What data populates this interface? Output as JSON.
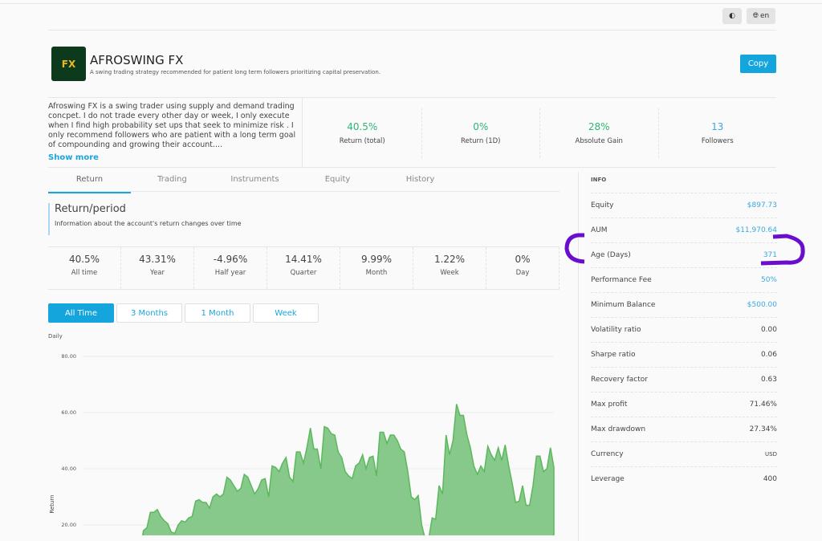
{
  "topbar": {
    "theme_icon": "half-circle-icon",
    "lang_icon": "globe-icon",
    "lang": "en"
  },
  "header": {
    "logo_text": "FX",
    "title": "AFROSWING FX",
    "subtitle": "A swing trading strategy recommended for patient long term followers prioritizing capital preservation.",
    "copy_label": "Copy"
  },
  "description": {
    "text": "Afroswing FX is a swing trader using supply and demand trading concpet. I do not trade every other day or week, I only execute when I find high probability set ups that seek to minimize risk . I only recommend followers who are patient with a long term goal of compounding and growing their account....",
    "show_more": "Show more"
  },
  "stats": [
    {
      "value": "40.5%",
      "label": "Return (total)",
      "color": "#2bb673"
    },
    {
      "value": "0%",
      "label": "Return (1D)",
      "color": "#2bb673"
    },
    {
      "value": "28%",
      "label": "Absolute Gain",
      "color": "#2bb673"
    },
    {
      "value": "13",
      "label": "Followers",
      "color": "#3aa8e0"
    }
  ],
  "tabs": [
    {
      "label": "Return",
      "active": true
    },
    {
      "label": "Trading"
    },
    {
      "label": "Instruments"
    },
    {
      "label": "Equity"
    },
    {
      "label": "History"
    }
  ],
  "return_period": {
    "title": "Return/period",
    "subtitle": "Information about the account's return changes over time"
  },
  "periods": [
    {
      "value": "40.5%",
      "label": "All time"
    },
    {
      "value": "43.31%",
      "label": "Year"
    },
    {
      "value": "-4.96%",
      "label": "Half year"
    },
    {
      "value": "14.41%",
      "label": "Quarter"
    },
    {
      "value": "9.99%",
      "label": "Month"
    },
    {
      "value": "1.22%",
      "label": "Week"
    },
    {
      "value": "0%",
      "label": "Day"
    }
  ],
  "range_buttons": [
    {
      "label": "All Time",
      "active": true
    },
    {
      "label": "3 Months"
    },
    {
      "label": "1 Month"
    },
    {
      "label": "Week"
    }
  ],
  "info": {
    "heading": "INFO",
    "rows": [
      {
        "label": "Equity",
        "value": "$897.73",
        "blue": true
      },
      {
        "label": "AUM",
        "value": "$11,970.64",
        "blue": true
      },
      {
        "label": "Age (Days)",
        "value": "371",
        "blue": true
      },
      {
        "label": "Performance Fee",
        "value": "50%",
        "blue": true
      },
      {
        "label": "Minimum Balance",
        "value": "$500.00",
        "blue": true
      },
      {
        "label": "Volatility ratio",
        "value": "0.00"
      },
      {
        "label": "Sharpe ratio",
        "value": "0.06"
      },
      {
        "label": "Recovery factor",
        "value": "0.63"
      },
      {
        "label": "Max profit",
        "value": "71.46%"
      },
      {
        "label": "Max drawdown",
        "value": "27.34%"
      },
      {
        "label": "Currency",
        "value": "USD"
      },
      {
        "label": "Leverage",
        "value": "400"
      }
    ]
  },
  "annotation_color": "#6a0dcc",
  "chart_data": {
    "type": "area",
    "title": "Daily",
    "ylabel": "Return",
    "ylim": [
      null,
      80
    ],
    "yticks": [
      "80.00",
      "60.00",
      "40.00",
      "20.00"
    ],
    "ytick_values": [
      80,
      60,
      40,
      20
    ],
    "grid": true,
    "color": "#5cb85c",
    "values": [
      10,
      10,
      10,
      10,
      10,
      10,
      10,
      10,
      10,
      10,
      10,
      10,
      10,
      10,
      10,
      10,
      10,
      18,
      19,
      24.5,
      24.5,
      25.5,
      23,
      21.5,
      20.5,
      17.5,
      17,
      20,
      21.5,
      21,
      22.5,
      23,
      28.5,
      29,
      28,
      28,
      26,
      30,
      31,
      30,
      31,
      37,
      36,
      34,
      32,
      33,
      38,
      37,
      34,
      31,
      33,
      36,
      36.5,
      30,
      41,
      40.5,
      39,
      42,
      44,
      37,
      35.5,
      46,
      46,
      42,
      47.5,
      54.5,
      47,
      47,
      40,
      55,
      54.5,
      52.5,
      52,
      46,
      44,
      39,
      37.5,
      36.5,
      41,
      42,
      45,
      40,
      44,
      44.5,
      37.5,
      53,
      53,
      49,
      52,
      52,
      50,
      47,
      46,
      39,
      30,
      29,
      30.5,
      20,
      15,
      15,
      22.5,
      22,
      34,
      31,
      52,
      45,
      50,
      63,
      59,
      59,
      52,
      47.5,
      41,
      38,
      41,
      39,
      48,
      45,
      43,
      47.5,
      43,
      48.5,
      41,
      35,
      28,
      28.5,
      34,
      27,
      27,
      34,
      44.5,
      44.5,
      39,
      40,
      47.5,
      40.5
    ]
  }
}
